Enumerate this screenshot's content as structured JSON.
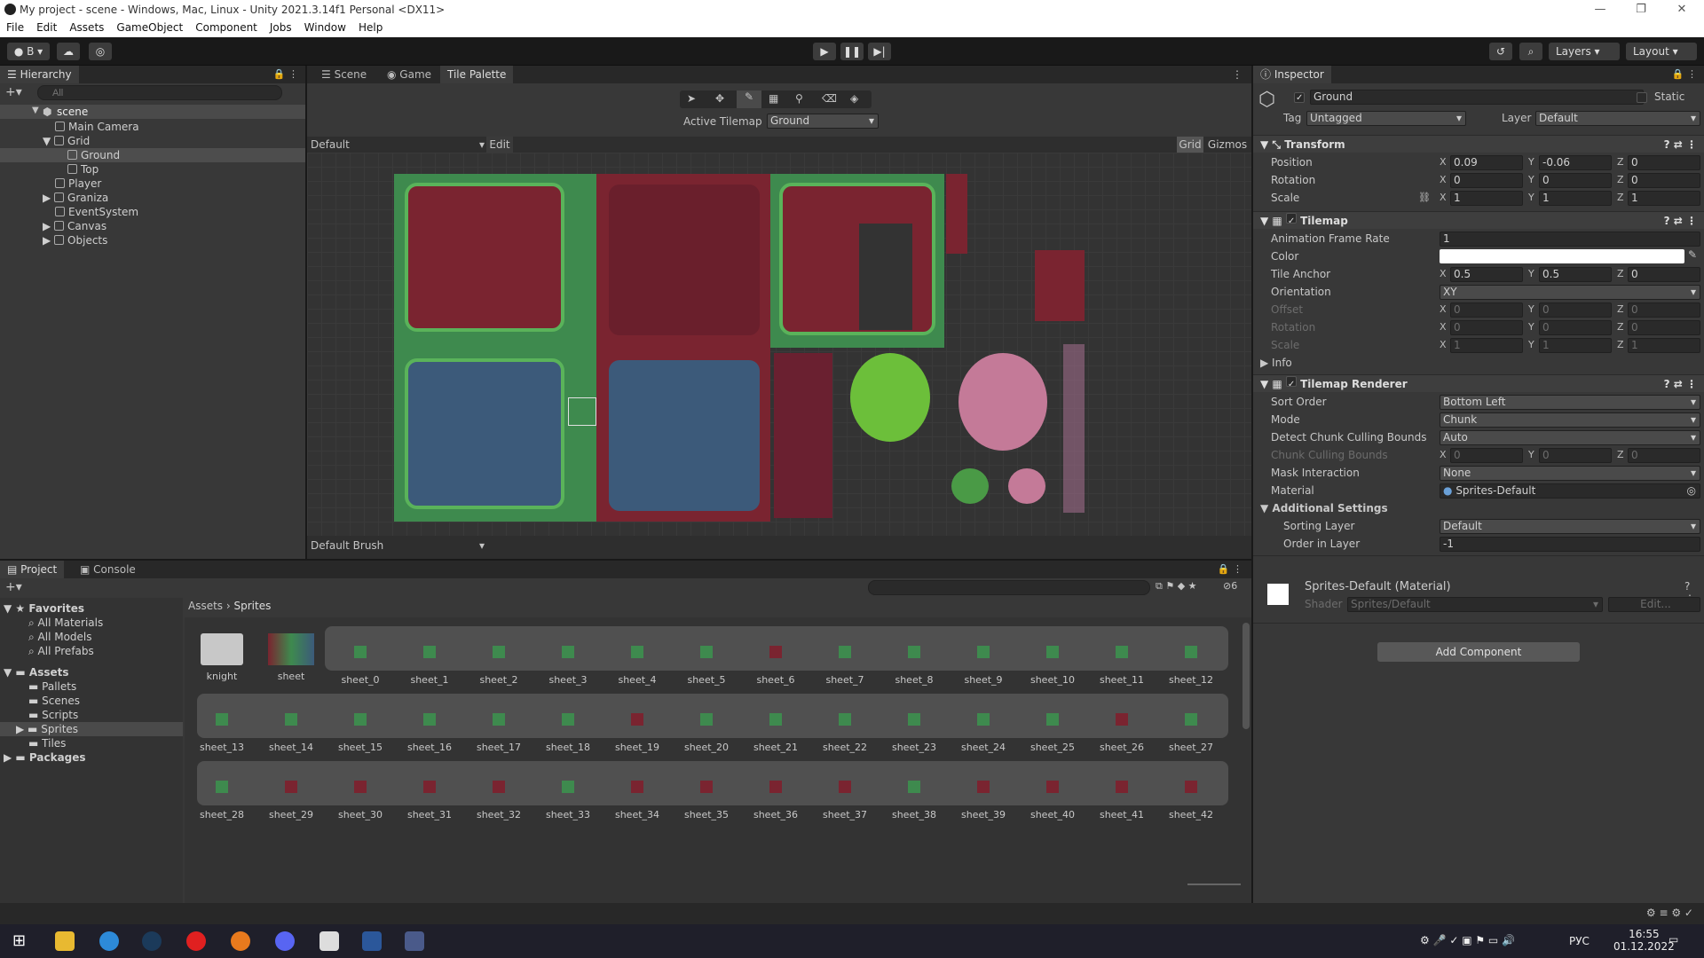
{
  "window": {
    "title": "My project - scene - Windows, Mac, Linux - Unity 2021.3.14f1 Personal <DX11>"
  },
  "menu": [
    "File",
    "Edit",
    "Assets",
    "GameObject",
    "Component",
    "Jobs",
    "Window",
    "Help"
  ],
  "toolbar": {
    "account": "B",
    "layers": "Layers",
    "layout": "Layout"
  },
  "hierarchy": {
    "tab": "Hierarchy",
    "search_placeholder": "All",
    "root": "scene",
    "items": [
      "Main Camera",
      "Grid",
      "Ground",
      "Top",
      "Player",
      "Graniza",
      "EventSystem",
      "Canvas",
      "Objects"
    ]
  },
  "scene_tabs": [
    "Scene",
    "Game",
    "Tile Palette"
  ],
  "palette": {
    "active_tilemap_label": "Active Tilemap",
    "active_tilemap": "Ground",
    "palette_name": "Default",
    "edit": "Edit",
    "grid": "Grid",
    "gizmos": "Gizmos",
    "brush": "Default Brush"
  },
  "inspector": {
    "tab": "Inspector",
    "object_name": "Ground",
    "static": "Static",
    "tag_label": "Tag",
    "tag": "Untagged",
    "layer_label": "Layer",
    "layer": "Default",
    "transform": {
      "title": "Transform",
      "position_label": "Position",
      "rotation_label": "Rotation",
      "scale_label": "Scale",
      "position": [
        "0.09",
        "-0.06",
        "0"
      ],
      "rotation": [
        "0",
        "0",
        "0"
      ],
      "scale": [
        "1",
        "1",
        "1"
      ]
    },
    "tilemap": {
      "title": "Tilemap",
      "anim_label": "Animation Frame Rate",
      "anim": "1",
      "color_label": "Color",
      "anchor_label": "Tile Anchor",
      "anchor": [
        "0.5",
        "0.5",
        "0"
      ],
      "orientation_label": "Orientation",
      "orientation": "XY",
      "offset_label": "Offset",
      "offset": [
        "0",
        "0",
        "0"
      ],
      "rotation_label": "Rotation",
      "rotation": [
        "0",
        "0",
        "0"
      ],
      "scale_label": "Scale",
      "scale": [
        "1",
        "1",
        "1"
      ],
      "info": "Info"
    },
    "renderer": {
      "title": "Tilemap Renderer",
      "sort_label": "Sort Order",
      "sort": "Bottom Left",
      "mode_label": "Mode",
      "mode": "Chunk",
      "detect_label": "Detect Chunk Culling Bounds",
      "detect": "Auto",
      "bounds_label": "Chunk Culling Bounds",
      "bounds": [
        "0",
        "0",
        "0"
      ],
      "mask_label": "Mask Interaction",
      "mask": "None",
      "material_label": "Material",
      "material": "Sprites-Default",
      "additional": "Additional Settings",
      "sorting_layer_label": "Sorting Layer",
      "sorting_layer": "Default",
      "order_label": "Order in Layer",
      "order": "-1"
    },
    "material": {
      "title": "Sprites-Default (Material)",
      "shader_label": "Shader",
      "shader": "Sprites/Default",
      "edit": "Edit..."
    },
    "add_component": "Add Component"
  },
  "project": {
    "tab_project": "Project",
    "tab_console": "Console",
    "favorites": "Favorites",
    "fav_items": [
      "All Materials",
      "All Models",
      "All Prefabs"
    ],
    "assets": "Assets",
    "asset_folders": [
      "Pallets",
      "Scenes",
      "Scripts",
      "Sprites",
      "Tiles"
    ],
    "packages": "Packages",
    "breadcrumb": [
      "Assets",
      "Sprites"
    ],
    "hidden_count": "6",
    "row1": [
      "knight",
      "sheet",
      "sheet_0",
      "sheet_1",
      "sheet_2",
      "sheet_3",
      "sheet_4",
      "sheet_5",
      "sheet_6",
      "sheet_7",
      "sheet_8",
      "sheet_9",
      "sheet_10",
      "sheet_11",
      "sheet_12"
    ],
    "row2": [
      "sheet_13",
      "sheet_14",
      "sheet_15",
      "sheet_16",
      "sheet_17",
      "sheet_18",
      "sheet_19",
      "sheet_20",
      "sheet_21",
      "sheet_22",
      "sheet_23",
      "sheet_24",
      "sheet_25",
      "sheet_26",
      "sheet_27"
    ],
    "row3": [
      "sheet_28",
      "sheet_29",
      "sheet_30",
      "sheet_31",
      "sheet_32",
      "sheet_33",
      "sheet_34",
      "sheet_35",
      "sheet_36",
      "sheet_37",
      "sheet_38",
      "sheet_39",
      "sheet_40",
      "sheet_41",
      "sheet_42"
    ]
  },
  "taskbar": {
    "lang": "РУС",
    "time": "16:55",
    "date": "01.12.2022"
  },
  "colors": {
    "grass": "#3e8a4e",
    "red": "#7a2430",
    "blue": "#3c5a7a",
    "accent": "#3d6a9e"
  }
}
